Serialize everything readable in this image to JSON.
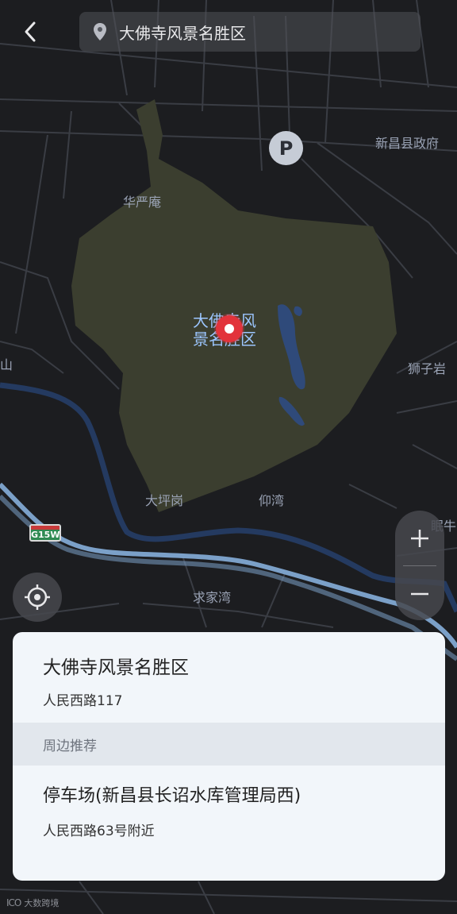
{
  "header": {
    "back_icon": "chevron-left-icon",
    "search_icon": "location-pin-icon",
    "search_text": "大佛寺风景名胜区"
  },
  "map": {
    "labels": {
      "huayan": "华严庵",
      "government": "新昌县政府",
      "shi": "山",
      "lion_rock": "狮子岩",
      "dapinggang": "大坪岗",
      "yangwan": "仰湾",
      "mianniu": "眠牛",
      "qiujiawan": "求家湾"
    },
    "center_label_line1": "大佛寺风",
    "center_label_line2": "景名胜区",
    "parking_marker": "P",
    "highway_shield": "G15W",
    "colors": {
      "background": "#1c1d20",
      "scenic_area": "#3b3e2f",
      "water": "#2f4a7a",
      "highway": "#7ba0c8",
      "pin": "#e2333b"
    }
  },
  "controls": {
    "zoom_in_icon": "plus-icon",
    "zoom_out_icon": "minus-icon",
    "locate_icon": "crosshair-icon"
  },
  "card": {
    "place_name": "大佛寺风景名胜区",
    "place_address": "人民西路117",
    "nearby_header": "周边推荐",
    "nearby_items": [
      {
        "name": "停车场(新昌县长诏水库管理局西)",
        "address": "人民西路63号附近"
      }
    ]
  },
  "watermark": {
    "logo": "ICO",
    "text": "大数跨境"
  }
}
